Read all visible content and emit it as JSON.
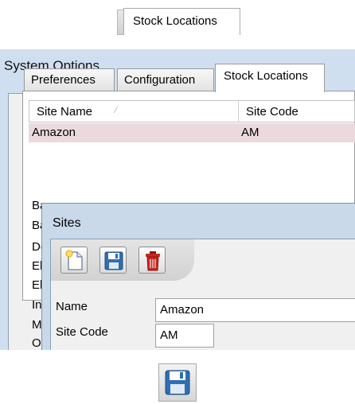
{
  "top_tab": {
    "label": "Stock Locations"
  },
  "window": {
    "title": "System Options"
  },
  "tabs": [
    {
      "label": "Preferences",
      "active": false
    },
    {
      "label": "Configuration",
      "active": false
    },
    {
      "label": "Stock Locations",
      "active": true
    }
  ],
  "grid": {
    "columns": [
      {
        "label": "Site Name",
        "sort": "ascending"
      },
      {
        "label": "Site Code"
      }
    ],
    "rows": [
      {
        "name": "Amazon",
        "code": "AM",
        "selected": true
      }
    ],
    "row_stubs": [
      "Ba",
      "Ba",
      "De",
      "Eb",
      "Eb",
      "In",
      "M",
      "O"
    ]
  },
  "sites_dialog": {
    "title": "Sites",
    "toolbar": [
      {
        "icon": "new-document-icon"
      },
      {
        "icon": "floppy-disk-icon"
      },
      {
        "icon": "trash-icon"
      }
    ],
    "fields": {
      "name_label": "Name",
      "name_value": "Amazon",
      "code_label": "Site Code",
      "code_value": "AM"
    }
  },
  "standalone_icon": {
    "icon": "floppy-disk-icon"
  },
  "colors": {
    "selected_row": "#ecd9dd",
    "window_frame": "#cfdff0",
    "delete_red": "#c6281e",
    "save_blue": "#2f6fb0"
  }
}
